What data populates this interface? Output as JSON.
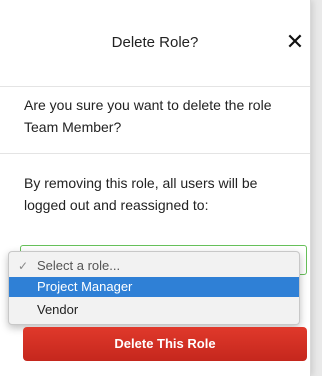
{
  "dialog": {
    "title": "Delete Role?",
    "close_glyph": "✕",
    "question": "Are you sure you want to delete the role Team Member?",
    "warning": "By removing this role, all users will be logged out and reassigned to:"
  },
  "role_select": {
    "options": [
      {
        "label": "Select a role...",
        "check_glyph": "✓"
      },
      {
        "label": "Project Manager"
      },
      {
        "label": "Vendor"
      }
    ],
    "highlighted_option": "Project Manager"
  },
  "actions": {
    "delete_label": "Delete This Role"
  },
  "colors": {
    "accent_green": "#67c05a",
    "highlight_blue": "#2f80d6",
    "danger_red": "#d63023"
  },
  "icons": {
    "close": "close-icon",
    "check": "checkmark-icon"
  }
}
